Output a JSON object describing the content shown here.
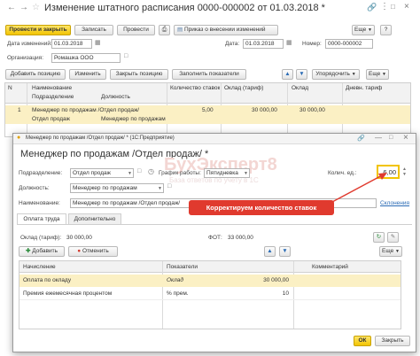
{
  "main": {
    "title": "Изменение штатного расписания 0000-000002 от 01.03.2018 *",
    "toolbar": {
      "post_close": "Провести и закрыть",
      "save": "Записать",
      "post": "Провести",
      "order": "Приказ о внесении изменений",
      "more": "Еще"
    },
    "date_change_label": "Дата изменений:",
    "date_change_value": "01.03.2018",
    "date_label": "Дата:",
    "date_value": "01.03.2018",
    "number_label": "Номер:",
    "number_value": "0000-000002",
    "org_label": "Организация:",
    "org_value": "Ромашка ООО",
    "table_toolbar": {
      "add": "Добавить позицию",
      "change": "Изменить",
      "close": "Закрыть позицию",
      "fill": "Заполнить показатели",
      "sort": "Упорядочить",
      "more": "Еще"
    },
    "columns": {
      "n": "N",
      "name": "Наименование",
      "division": "Подразделение",
      "position": "Должность",
      "rates": "Количество ставок",
      "salary_tariff": "Оклад (тариф)",
      "salary": "Оклад",
      "daily_tariff": "Дневн. тариф"
    },
    "row": {
      "n": "1",
      "name": "Менеджер по продажам /Отдел продаж/",
      "division": "Отдел продаж",
      "position": "Менеджер по продажам",
      "rates": "5,00",
      "salary_tariff": "30 000,00",
      "salary": "30 000,00"
    }
  },
  "dialog": {
    "caption": "Менеджер по продажам /Отдел продаж/ * (1С:Предприятие)",
    "title": "Менеджер по продажам /Отдел продаж/ *",
    "division_label": "Подразделение:",
    "division_value": "Отдел продаж",
    "schedule_label": "График работы:",
    "schedule_value": "Пятидневка",
    "rates_label": "Колич. ед.:",
    "rates_value": "6,00",
    "position_label": "Должность:",
    "position_value": "Менеджер по продажам",
    "name_label": "Наименование:",
    "name_value": "Менеджер по продажам /Отдел продаж/",
    "declensions": "Склонения",
    "callout": "Корректируем количество ставок",
    "watermark": "БухЭксперт8",
    "watermark_sub": "База ответов по учету в 1С",
    "tabs": [
      "Оплата труда",
      "Дополнительно"
    ],
    "salary_label": "Оклад (тариф):",
    "salary_value": "30 000,00",
    "fot_label": "ФОТ:",
    "fot_value": "33 000,00",
    "add": "Добавить",
    "cancel": "Отменить",
    "more": "Еще",
    "columns": {
      "accrual": "Начисление",
      "indicators": "Показатели",
      "comment": "Комментарий"
    },
    "rows": [
      {
        "accrual": "Оплата по окладу",
        "indicator": "Оклад",
        "value": "30 000,00"
      },
      {
        "accrual": "Премия ежемесячная процентом",
        "indicator": "% прем.",
        "value": "10"
      }
    ],
    "ok": "ОК",
    "close": "Закрыть"
  },
  "colors": {
    "accent": "#f2c400",
    "selection": "#fbf0c4",
    "callout": "#e03a2e",
    "title_link": "#2a6bb5"
  }
}
